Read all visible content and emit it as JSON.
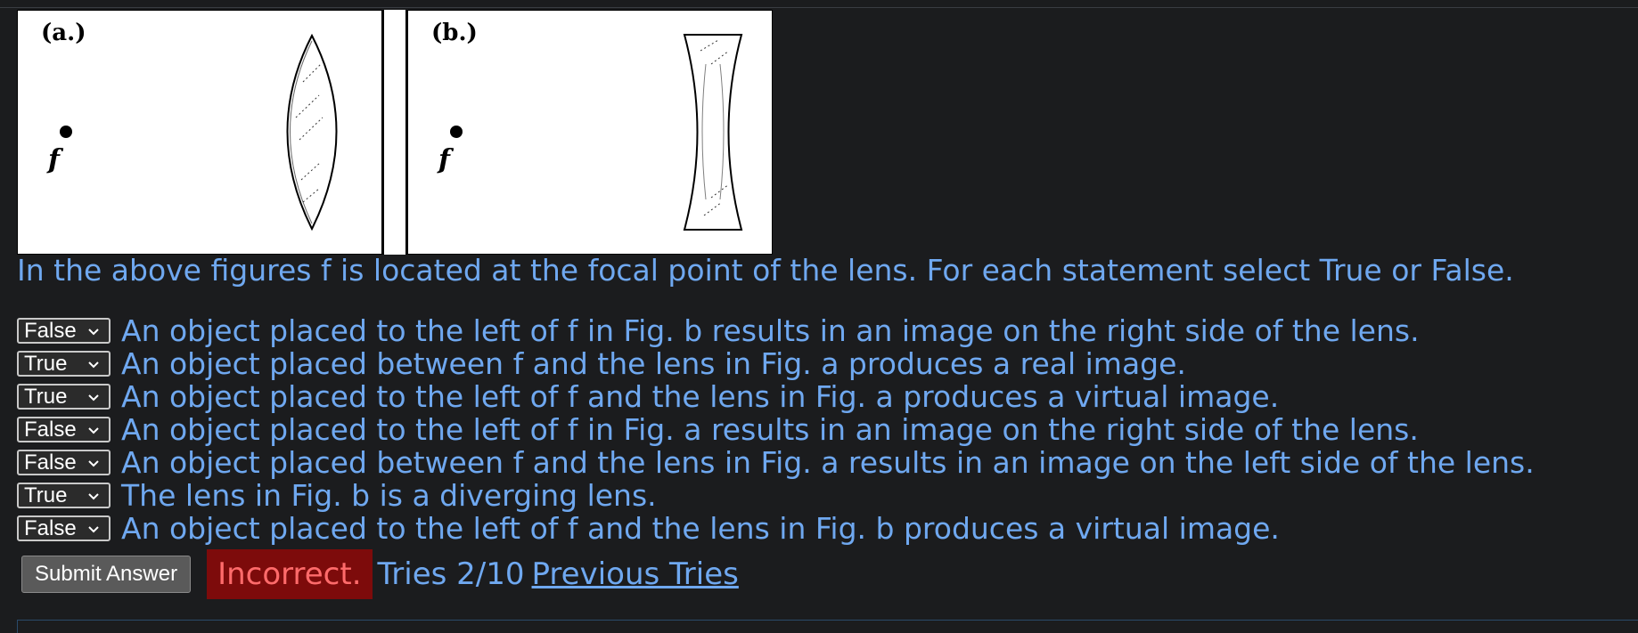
{
  "figures": {
    "a": {
      "label": "(a.)",
      "focal_label": "f",
      "lens": "converging"
    },
    "b": {
      "label": "(b.)",
      "focal_label": "f",
      "lens": "diverging"
    }
  },
  "instruction": "In the above figures f is located at the focal point of the lens. For each statement select True or False.",
  "statements": [
    {
      "selected": "False",
      "text": "An object placed to the left of f in Fig. b results in an image on the right side of the lens."
    },
    {
      "selected": "True",
      "text": "An object placed between f and the lens in Fig. a produces a real image."
    },
    {
      "selected": "True",
      "text": "An object placed to the left of f and the lens in Fig. a produces a virtual image."
    },
    {
      "selected": "False",
      "text": "An object placed to the left of f in Fig. a results in an image on the right side of the lens."
    },
    {
      "selected": "False",
      "text": "An object placed between f and the lens in Fig. a results in an image on the left side of the lens."
    },
    {
      "selected": "True",
      "text": "The lens in Fig. b is a diverging lens."
    },
    {
      "selected": "False",
      "text": "An object placed to the left of f and the lens in Fig. b produces a virtual image."
    }
  ],
  "actions": {
    "submit_label": "Submit Answer",
    "status": "Incorrect.",
    "tries": "Tries 2/10",
    "previous_tries_label": "Previous Tries"
  },
  "colors": {
    "background": "#1b1c1e",
    "text_accent": "#6fa8f0",
    "status_bg": "#7d0b0b",
    "status_text": "#ff6b6b"
  },
  "icons": {
    "dropdown": "chevron-down-icon"
  }
}
